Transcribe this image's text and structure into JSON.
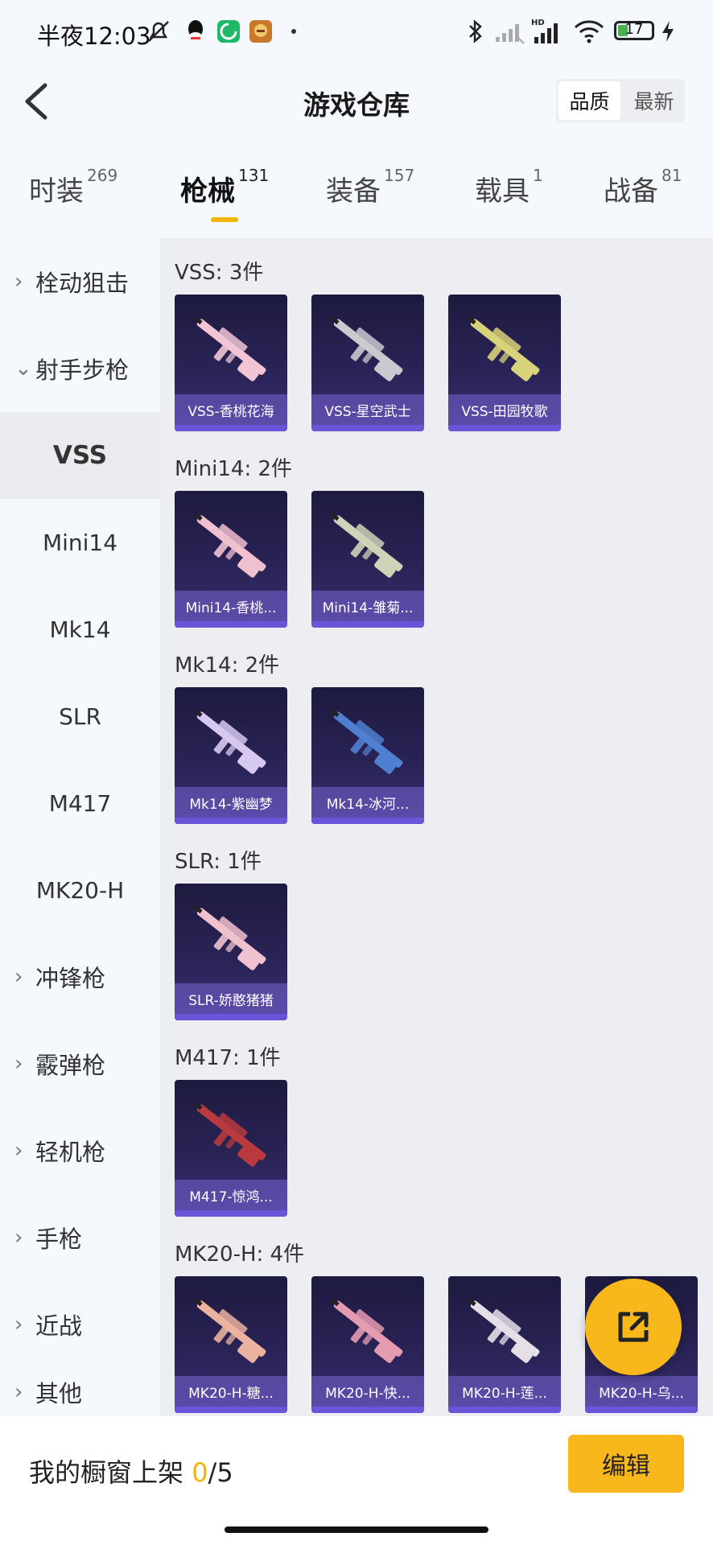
{
  "status_bar": {
    "time": "半夜12:03",
    "battery": "17",
    "hd": "HD"
  },
  "header": {
    "title": "游戏仓库",
    "sort_options": [
      "品质",
      "最新"
    ]
  },
  "tabs": [
    {
      "label": "时装",
      "count": "269"
    },
    {
      "label": "枪械",
      "count": "131"
    },
    {
      "label": "装备",
      "count": "157"
    },
    {
      "label": "载具",
      "count": "1"
    },
    {
      "label": "战备",
      "count": "81"
    }
  ],
  "sidebar": [
    {
      "label": "栓动狙击",
      "chevron": "›"
    },
    {
      "label": "射手步枪",
      "chevron": "⌄"
    },
    {
      "label": "VSS"
    },
    {
      "label": "Mini14"
    },
    {
      "label": "Mk14"
    },
    {
      "label": "SLR"
    },
    {
      "label": "M417"
    },
    {
      "label": "MK20-H"
    },
    {
      "label": "冲锋枪",
      "chevron": "›"
    },
    {
      "label": "霰弹枪",
      "chevron": "›"
    },
    {
      "label": "轻机枪",
      "chevron": "›"
    },
    {
      "label": "手枪",
      "chevron": "›"
    },
    {
      "label": "近战",
      "chevron": "›"
    },
    {
      "label": "其他",
      "chevron": "›"
    }
  ],
  "groups": [
    {
      "title": "VSS: 3件",
      "items": [
        {
          "label": "VSS-香桃花海",
          "color": "#f2c4d6"
        },
        {
          "label": "VSS-星空武士",
          "color": "#c9c9cf"
        },
        {
          "label": "VSS-田园牧歌",
          "color": "#d8d27a"
        }
      ]
    },
    {
      "title": "Mini14: 2件",
      "items": [
        {
          "label": "Mini14-香桃...",
          "color": "#f1c0cf"
        },
        {
          "label": "Mini14-雏菊...",
          "color": "#cfd3b8"
        }
      ]
    },
    {
      "title": "Mk14: 2件",
      "items": [
        {
          "label": "Mk14-紫幽梦",
          "color": "#d7c8ef"
        },
        {
          "label": "Mk14-冰河...",
          "color": "#4f7fd0"
        }
      ]
    },
    {
      "title": "SLR: 1件",
      "items": [
        {
          "label": "SLR-娇憨猪猪",
          "color": "#f0c2ce"
        }
      ]
    },
    {
      "title": "M417: 1件",
      "items": [
        {
          "label": "M417-惊鸿...",
          "color": "#b83a3e"
        }
      ]
    },
    {
      "title": "MK20-H: 4件",
      "items": [
        {
          "label": "MK20-H-糖...",
          "color": "#eab29f"
        },
        {
          "label": "MK20-H-快...",
          "color": "#e59bb0"
        },
        {
          "label": "MK20-H-莲...",
          "color": "#e6dfe8"
        },
        {
          "label": "MK20-H-乌...",
          "color": "#8a8a8a"
        }
      ]
    }
  ],
  "bottom": {
    "prefix": "我的橱窗上架 ",
    "current": "0",
    "suffix": "/5",
    "edit_label": "编辑"
  }
}
